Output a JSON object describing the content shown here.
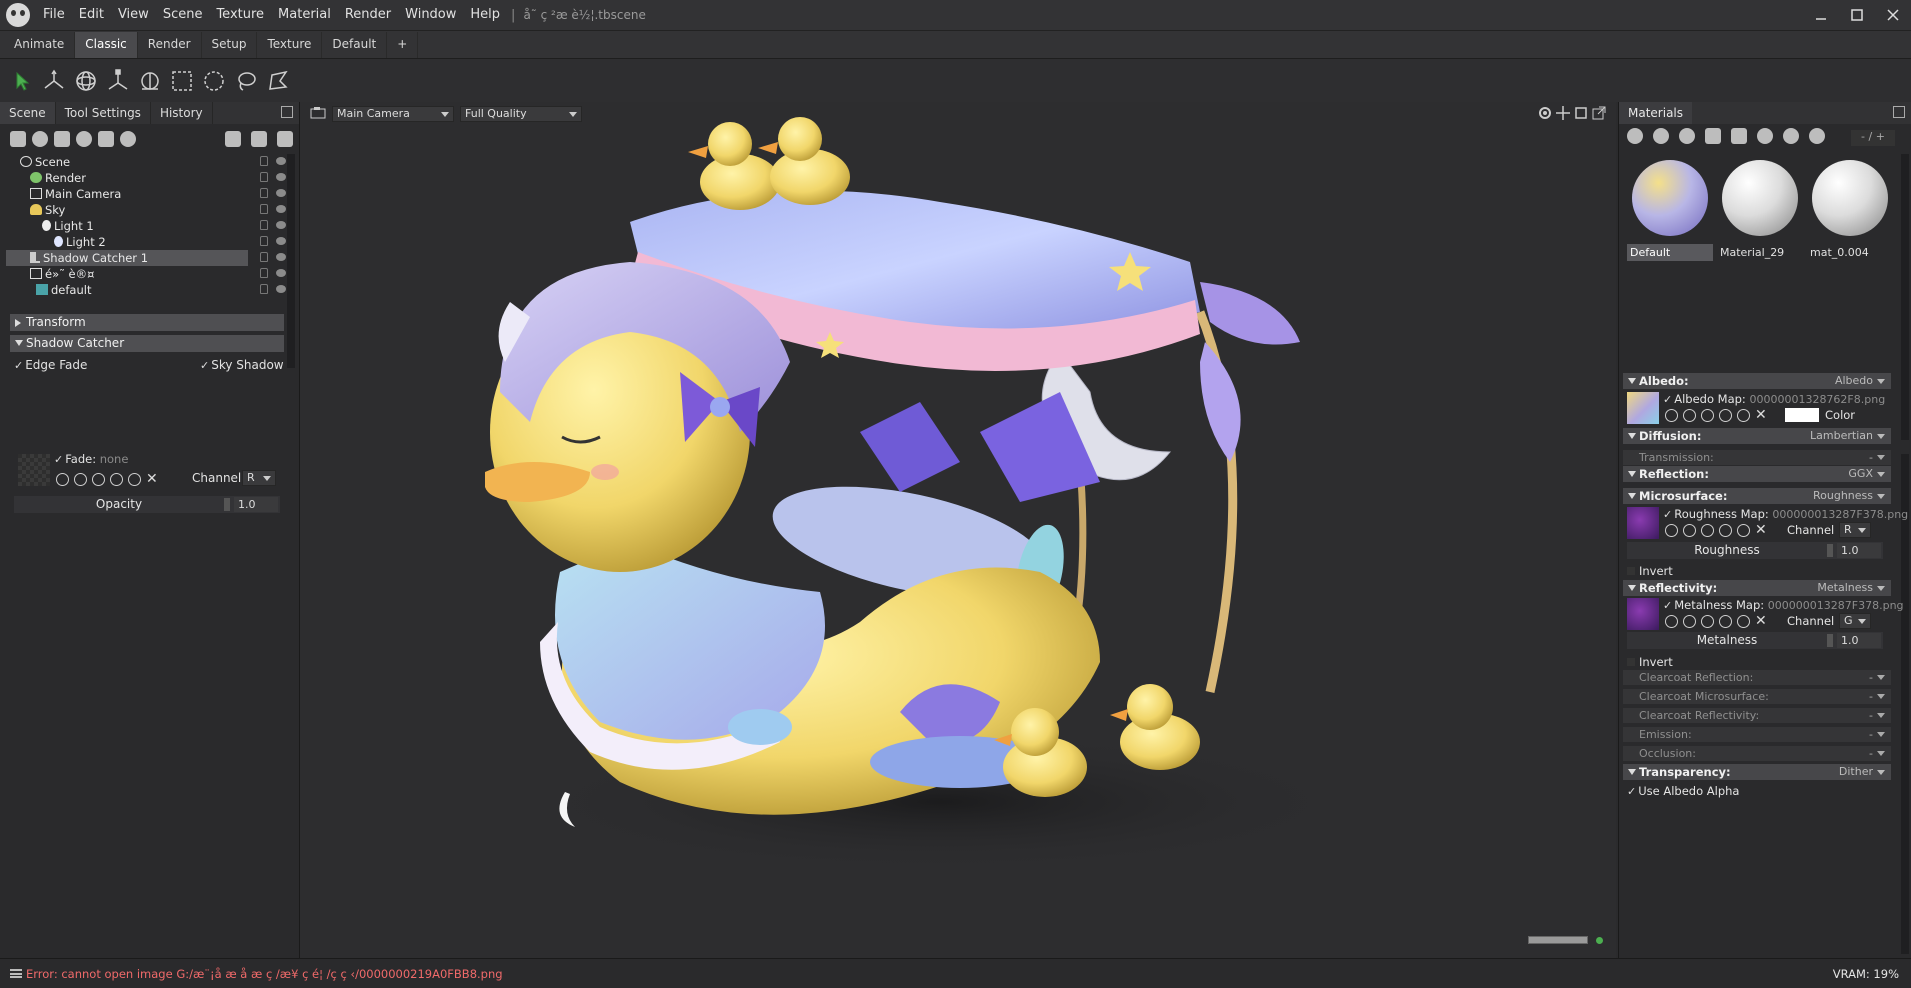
{
  "titlebar": {
    "menus": [
      "File",
      "Edit",
      "View",
      "Scene",
      "Texture",
      "Material",
      "Render",
      "Window",
      "Help"
    ],
    "separator": "|",
    "scene_title": "å˜ ç ²æ è½¦.tbscene"
  },
  "workspace_tabs": [
    "Animate",
    "Classic",
    "Render",
    "Setup",
    "Texture",
    "Default",
    "+"
  ],
  "active_workspace": "Classic",
  "left_panel": {
    "tabs": [
      "Scene",
      "Tool Settings",
      "History"
    ],
    "tree": [
      {
        "label": "Scene",
        "depth": 0
      },
      {
        "label": "Render",
        "depth": 1
      },
      {
        "label": "Main Camera",
        "depth": 1
      },
      {
        "label": "Sky",
        "depth": 1
      },
      {
        "label": "Light 1",
        "depth": 2
      },
      {
        "label": "Light 2",
        "depth": 3
      },
      {
        "label": "Shadow Catcher 1",
        "depth": 1
      },
      {
        "label": "é»˜ è®¤",
        "depth": 1
      },
      {
        "label": "default",
        "depth": 2
      }
    ],
    "selected_item": "Shadow Catcher 1",
    "transform_label": "Transform",
    "shadow_catcher_label": "Shadow Catcher",
    "edge_fade": "Edge Fade",
    "sky_shadow": "Sky Shadow",
    "fade_label": "Fade:",
    "fade_value": "none",
    "channel_label": "Channel",
    "channel_value": "R",
    "opacity_label": "Opacity",
    "opacity_value": "1.0"
  },
  "viewport": {
    "camera": "Main Camera",
    "quality": "Full Quality"
  },
  "materials": {
    "tab": "Materials",
    "page": "- / +",
    "items": [
      {
        "name": "Default",
        "selected": true
      },
      {
        "name": "Material_29",
        "selected": false
      },
      {
        "name": "mat_0.004",
        "selected": false
      }
    ]
  },
  "properties": {
    "albedo": {
      "label": "Albedo:",
      "value": "Albedo",
      "map_label": "Albedo Map:",
      "map_file": "00000001328762F8.png",
      "color_label": "Color"
    },
    "diffusion": {
      "label": "Diffusion:",
      "value": "Lambertian"
    },
    "transmission": {
      "label": "Transmission:",
      "value": "-"
    },
    "reflection": {
      "label": "Reflection:",
      "value": "GGX"
    },
    "microsurface": {
      "label": "Microsurface:",
      "value": "Roughness",
      "map_label": "Roughness Map:",
      "map_file": "000000013287F378.png",
      "channel_label": "Channel",
      "channel_value": "R",
      "slider_label": "Roughness",
      "slider_value": "1.0",
      "invert": "Invert"
    },
    "reflectivity": {
      "label": "Reflectivity:",
      "value": "Metalness",
      "map_label": "Metalness Map:",
      "map_file": "000000013287F378.png",
      "channel_label": "Channel",
      "channel_value": "G",
      "slider_label": "Metalness",
      "slider_value": "1.0",
      "invert": "Invert"
    },
    "collapsed": [
      {
        "label": "Clearcoat Reflection:",
        "value": "-"
      },
      {
        "label": "Clearcoat Microsurface:",
        "value": "-"
      },
      {
        "label": "Clearcoat Reflectivity:",
        "value": "-"
      },
      {
        "label": "Emission:",
        "value": "-"
      },
      {
        "label": "Occlusion:",
        "value": "-"
      }
    ],
    "transparency": {
      "label": "Transparency:",
      "value": "Dither",
      "use_albedo_alpha": "Use Albedo Alpha"
    }
  },
  "status": {
    "error": "Error: cannot open image G:/æ¨¡å  æ   å   æ ç  /æ¥ ç  é¦ /ç   ç  ‹/0000000219A0FBB8.png",
    "vram": "VRAM: 19%"
  },
  "colors": {
    "accent_select": "#4caf50",
    "error_text": "#f06a6a",
    "duck_yellow": "#f3dc73",
    "canopy_lavender": "#a9b3f0"
  }
}
